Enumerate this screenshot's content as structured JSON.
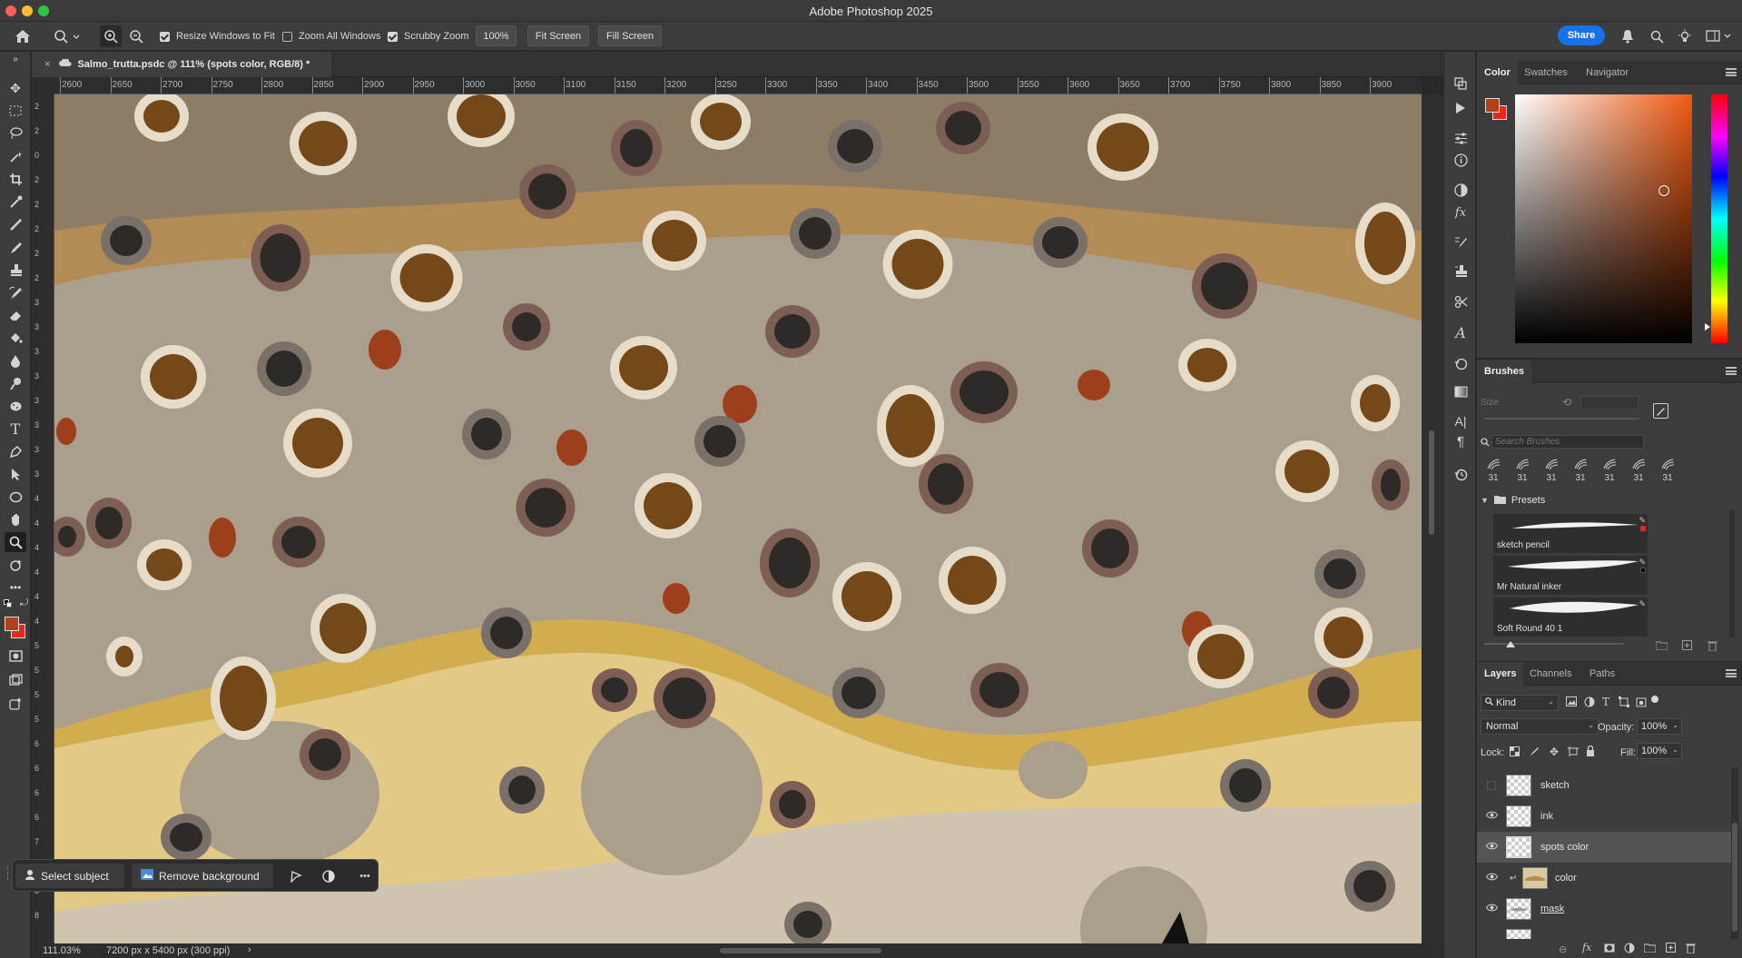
{
  "window": {
    "title": "Adobe Photoshop 2025"
  },
  "options_bar": {
    "resize_windows": "Resize Windows to Fit",
    "zoom_all": "Zoom All Windows",
    "scrubby_zoom": "Scrubby Zoom",
    "zoom_value": "100%",
    "fit_screen": "Fit Screen",
    "fill_screen": "Fill Screen",
    "share": "Share"
  },
  "document": {
    "tab_title": "Salmo_trutta.psdc @ 111% (spots color, RGB/8) *",
    "ruler_labels": [
      "2600",
      "2650",
      "2700",
      "2750",
      "2800",
      "2850",
      "2900",
      "2950",
      "3000",
      "3050",
      "3100",
      "3150",
      "3200",
      "3250",
      "3300",
      "3350",
      "3400",
      "3450",
      "3500",
      "3550",
      "3600",
      "3650",
      "3700",
      "3750",
      "3800",
      "3850",
      "3900"
    ],
    "vruler_labels": [
      "2",
      "2",
      "0",
      "2",
      "2",
      "2",
      "2",
      "2",
      "3",
      "3",
      "3",
      "3",
      "3",
      "3",
      "3",
      "3",
      "4",
      "4",
      "4",
      "4",
      "4",
      "4",
      "5",
      "5",
      "5",
      "5",
      "6",
      "6",
      "6",
      "6",
      "7",
      "7",
      "8",
      "8"
    ],
    "zoom_status": "111.03%",
    "size_status": "7200 px x 5400 px (300 ppi)",
    "status_arrow": "›"
  },
  "context_bar": {
    "select_subject": "Select subject",
    "remove_background": "Remove background",
    "more": "•••"
  },
  "color_panel": {
    "tabs": [
      "Color",
      "Swatches",
      "Navigator"
    ],
    "foreground": "#b3401d",
    "background": "#e8261c",
    "hue_color": "#f05a12"
  },
  "brushes_panel": {
    "title": "Brushes",
    "size_label": "Size:",
    "search_placeholder": "Search Brushes",
    "recent_sizes": [
      "31",
      "31",
      "31",
      "31",
      "31",
      "31",
      "31"
    ],
    "folder": "Presets",
    "brushes": [
      {
        "name": "sketch pencil"
      },
      {
        "name": "Mr Natural inker"
      },
      {
        "name": "Soft Round 40 1"
      }
    ]
  },
  "layers_panel": {
    "tabs": [
      "Layers",
      "Channels",
      "Paths"
    ],
    "filter": "Kind",
    "blend_mode": "Normal",
    "opacity_label": "Opacity:",
    "opacity": "100%",
    "lock_label": "Lock:",
    "fill_label": "Fill:",
    "fill": "100%",
    "layers": [
      {
        "name": "sketch",
        "visible": false,
        "selected": false
      },
      {
        "name": "ink",
        "visible": true,
        "selected": false
      },
      {
        "name": "spots color",
        "visible": true,
        "selected": true
      },
      {
        "name": "color",
        "visible": true,
        "selected": false,
        "clipped": true
      },
      {
        "name": "mask",
        "visible": true,
        "selected": false
      }
    ]
  }
}
